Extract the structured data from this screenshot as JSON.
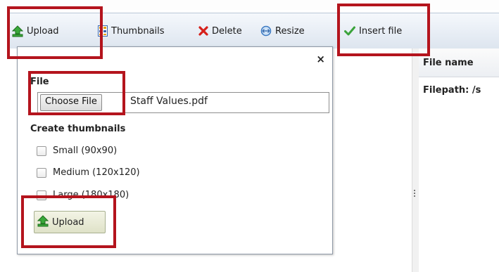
{
  "toolbar": {
    "upload": "Upload",
    "thumbnails": "Thumbnails",
    "delete": "Delete",
    "resize": "Resize",
    "insert_file": "Insert file"
  },
  "upload_panel": {
    "close_glyph": "×",
    "file_label": "File",
    "choose_button": "Choose File",
    "selected_file": "Staff Values.pdf",
    "thumbnails_label": "Create thumbnails",
    "options": [
      {
        "label": "Small (90x90)",
        "checked": false
      },
      {
        "label": "Medium (120x120)",
        "checked": false
      },
      {
        "label": "Large (180x180)",
        "checked": false
      }
    ],
    "upload_button": "Upload"
  },
  "file_list": {
    "column_header": "File name",
    "filepath": "Filepath: /s"
  },
  "colors": {
    "highlight": "#b4141d",
    "toolbar_bg": "#dde5ef"
  },
  "icons": [
    "upload-arrow-icon",
    "thumbnails-grid-icon",
    "delete-x-icon",
    "resize-icon",
    "checkmark-icon",
    "close-icon"
  ]
}
